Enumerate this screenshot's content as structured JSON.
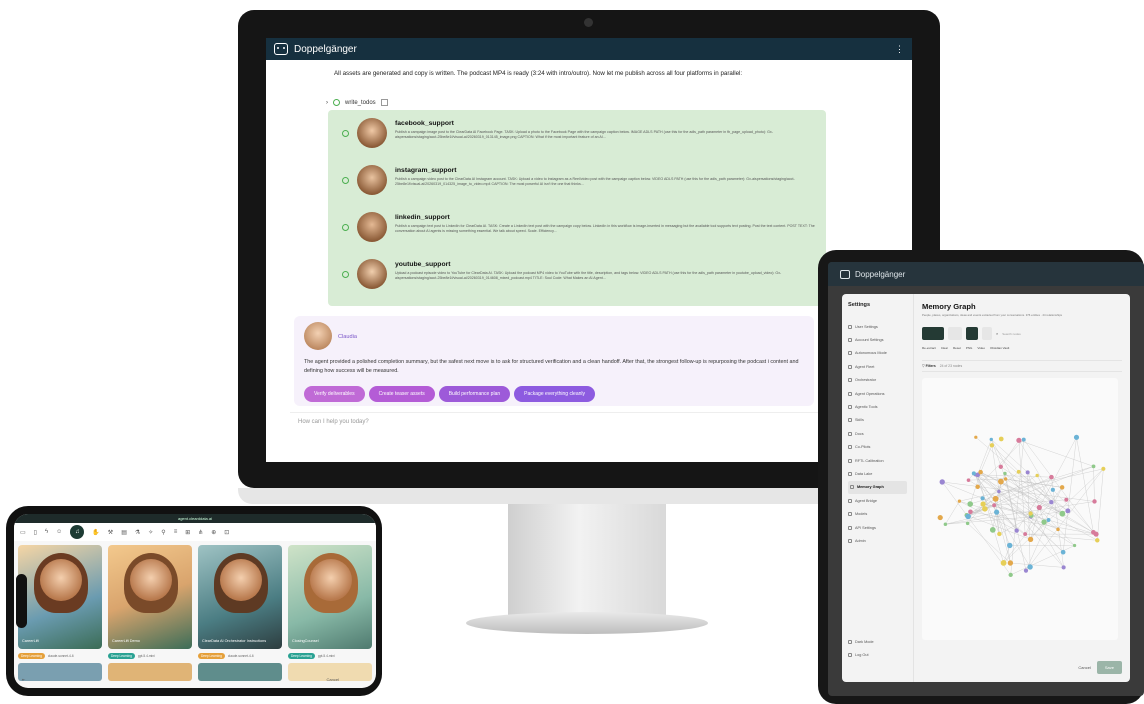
{
  "monitor": {
    "app_title": "Doppelgänger",
    "menu_glyph": "⋮",
    "intro": "All assets are generated and copy is written. The podcast MP4 is ready (3:24 with intro/outro). Now let me publish across all four platforms in parallel:",
    "todos_label": "write_todos",
    "tasks": [
      {
        "name": "facebook_support",
        "desc": "Publish a campaign image post to the ClearData AI Facebook Page. TASK: Upload a photo to the Facebook Page with the campaign caption below. IMAGE ADLS PATH (use this for the adls_path parameter in fb_page_upload_photo): Gx-aispersations/staging/acct-25be8e1f/visual-ai/20260319_013145_image.png CAPTION: What if the most important feature of an AI...",
        "avatar": "#f0c9a6"
      },
      {
        "name": "instagram_support",
        "desc": "Publish a campaign video post to the ClearData AI Instagram account. TASK: Upload a video to Instagram as a Reel/video post with the campaign caption below. VIDEO ADLS PATH (use this for the adls_path parameter): Gx-aispersations/staging/acct-25be8e1f/visual-ai/20260319_014325_image_to_video.mp4 CAPTION: The most powerful AI isn't the one that thinks...",
        "avatar": "#e9c3a0"
      },
      {
        "name": "linkedin_support",
        "desc": "Publish a campaign text post to LinkedIn for ClearData AI. TASK: Create a LinkedIn text post with the campaign copy below. LinkedIn in this workflow is image-inserted in messaging but the available tool supports text posting. Post the text content. POST TEXT: The conversation about AI agents is missing something essential. We talk about speed. Scale. Efficiency...",
        "avatar": "#e4b994"
      },
      {
        "name": "youtube_support",
        "desc": "Upload a podcast episode video to YouTube for ClearData AI. TASK: Upload the podcast MP4 video to YouTube with the title, description, and tags below. VIDEO ADLS PATH (use this for the adls_path parameter in youtube_upload_video): Gx-aispersations/staging/acct-25be8e1f/visual-ai/20260319_014608_mixed_podcast.mp4 TITLE: Soul Code: What Makes an AI Agent...",
        "avatar": "#f1cfae"
      }
    ],
    "agent": {
      "name": "Claudia",
      "message": "The agent provided a polished completion summary, but the safest next move is to ask for structured verification and a clean handoff. After that, the strongest follow-up is repurposing the podcast i content and defining how success will be measured.",
      "chips": [
        "Verify deliverables",
        "Create teaser assets",
        "Build performance plan",
        "Package everything cleanly"
      ]
    },
    "prompt_placeholder": "How can I help you today?"
  },
  "tablet": {
    "app_title": "Doppelgänger",
    "settings_title": "Settings",
    "nav": [
      "User Settings",
      "Account Settings",
      "Autonomous Mode",
      "Agent Fleet",
      "Orchestrator",
      "Agent Operations",
      "Agentic Tools",
      "Skills",
      "Docs",
      "Co-Pilots",
      "RFTL Calibration",
      "Data Lake",
      "Memory Graph",
      "Agent Bridge",
      "Models",
      "API Settings",
      "Admin"
    ],
    "nav_selected": "Memory Graph",
    "bottom_nav": [
      "Dark Mode",
      "Log Out"
    ],
    "panel_title": "Memory Graph",
    "panel_subtitle": "People, places, organizations, ideas and events extracted from your conversations. 376 entities · 24 relationships",
    "tools": [
      "Re-extract",
      "Clear",
      "Reset",
      "PNG",
      "Video",
      "Obsidian Vault"
    ],
    "search_placeholder": "Search nodes",
    "filters_label": "Filters",
    "filters_count": "24 of 23 nodes",
    "cancel_label": "Cancel",
    "save_label": "Save"
  },
  "phone": {
    "url": "agent.clearddata.ai",
    "cards": [
      {
        "label": "CareerLift",
        "tag": "Deep Learning",
        "tag_color": "orange",
        "meta": "claude-sonnet-4-6"
      },
      {
        "label": "CareerLift Demo",
        "tag": "Deep Learning",
        "tag_color": "teal",
        "meta": "gpt-5.4-mini"
      },
      {
        "label": "ClearData AI Orchestrator Instructions",
        "tag": "Deep Learning",
        "tag_color": "orange",
        "meta": "claude-sonnet-4-6"
      },
      {
        "label": "ClosingCounsel",
        "tag": "Deep Learning",
        "tag_color": "teal",
        "meta": "gpt-5.4-mini"
      }
    ],
    "bottom_left": "⇤",
    "bottom_right": "Cancel"
  }
}
